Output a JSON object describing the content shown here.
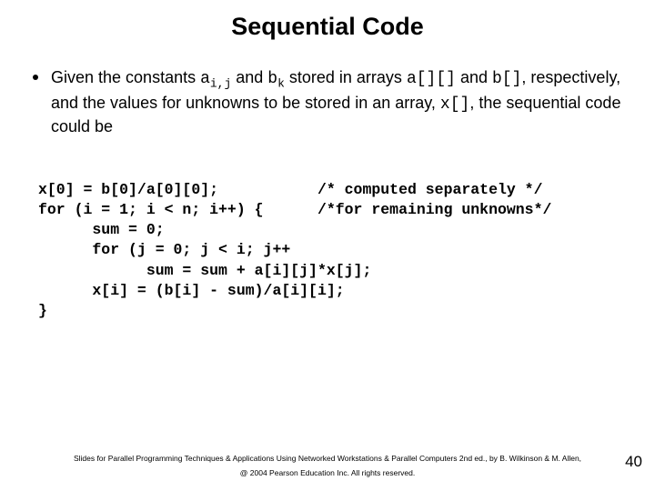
{
  "title": "Sequential Code",
  "bullet": {
    "t1": "Given the constants ",
    "a_ij": "a",
    "a_ij_sub": "i,j",
    "t2": " and ",
    "b_k": "b",
    "b_k_sub": "k",
    "t3": " stored in arrays ",
    "arr_a": "a[][]",
    "t4": " and ",
    "arr_b": "b[]",
    "t5": ", respectively, and the values for unknowns to be stored in an array, ",
    "arr_x": "x[]",
    "t6": ", the sequential code could be"
  },
  "code": "x[0] = b[0]/a[0][0];           /* computed separately */\nfor (i = 1; i < n; i++) {      /*for remaining unknowns*/\n      sum = 0;\n      for (j = 0; j < i; j++\n            sum = sum + a[i][j]*x[j];\n      x[i] = (b[i] - sum)/a[i][i];\n}",
  "footer": {
    "line1": "Slides for Parallel Programming Techniques & Applications Using Networked Workstations & Parallel Computers 2nd ed., by B. Wilkinson & M. Allen,",
    "line2": "@ 2004 Pearson Education Inc. All rights reserved."
  },
  "page_number": "40"
}
